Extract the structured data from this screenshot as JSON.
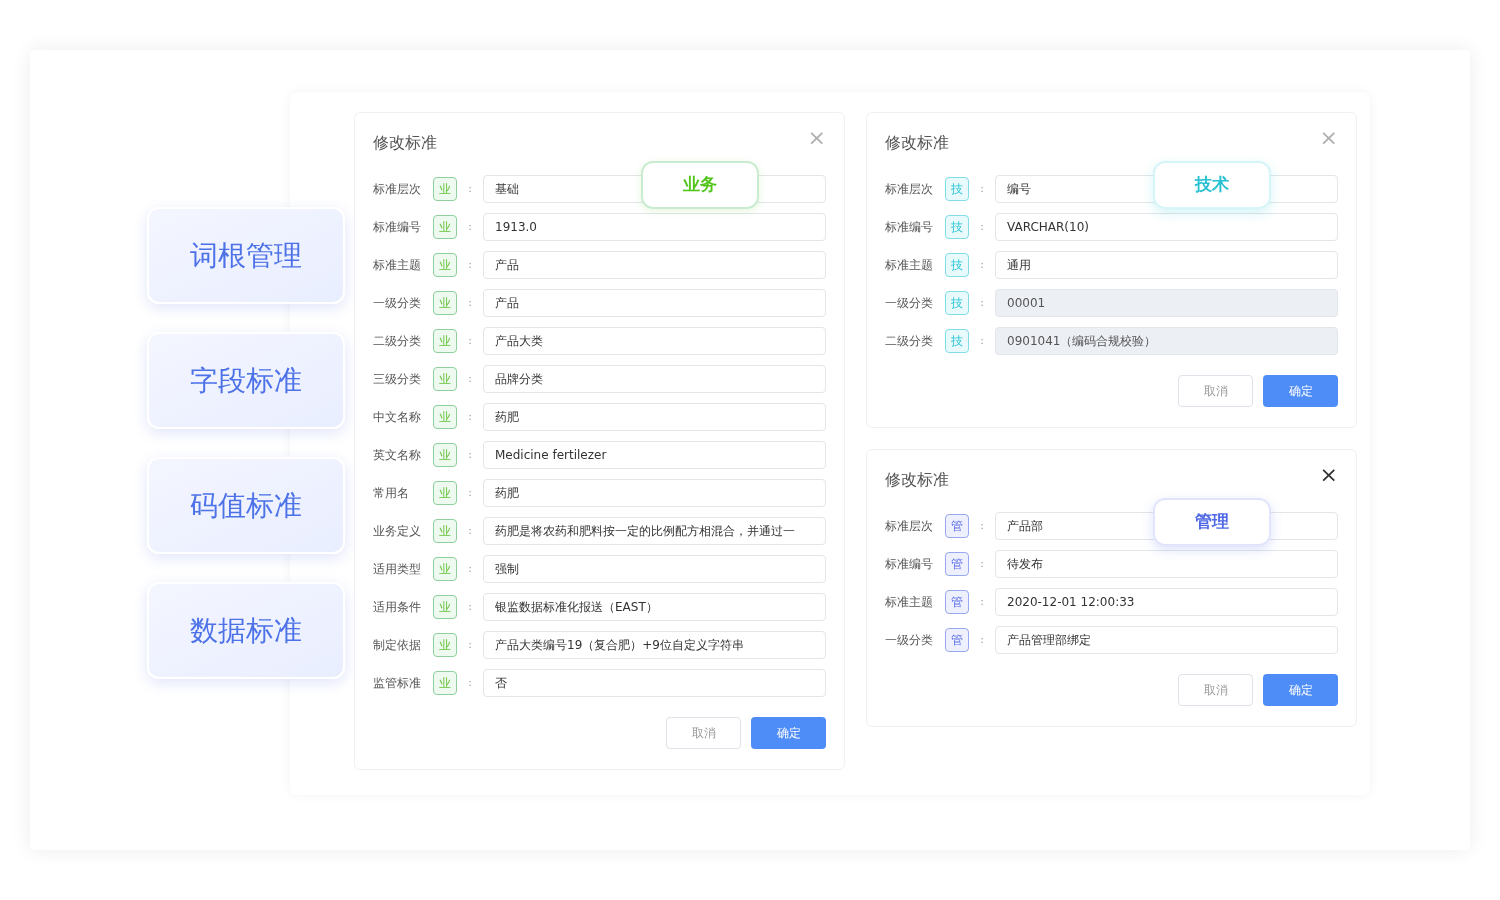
{
  "nav": [
    {
      "label": "词根管理"
    },
    {
      "label": "字段标准"
    },
    {
      "label": "码值标准"
    },
    {
      "label": "数据标准"
    }
  ],
  "dialogs": [
    {
      "title": "修改标准",
      "close": "×",
      "close_active": false,
      "kind": "business",
      "badge": "业务",
      "rows": [
        {
          "label": "标准层次",
          "tag": "业",
          "colon": ":",
          "value": "基础",
          "disabled": false
        },
        {
          "label": "标准编号",
          "tag": "业",
          "colon": ":",
          "value": "1913.0",
          "disabled": false
        },
        {
          "label": "标准主题",
          "tag": "业",
          "colon": ":",
          "value": "产品",
          "disabled": false
        },
        {
          "label": "一级分类",
          "tag": "业",
          "colon": ":",
          "value": "产品",
          "disabled": false
        },
        {
          "label": "二级分类",
          "tag": "业",
          "colon": ":",
          "value": "产品大类",
          "disabled": false
        },
        {
          "label": "三级分类",
          "tag": "业",
          "colon": ":",
          "value": "品牌分类",
          "disabled": false
        },
        {
          "label": "中文名称",
          "tag": "业",
          "colon": ":",
          "value": "药肥",
          "disabled": false
        },
        {
          "label": "英文名称",
          "tag": "业",
          "colon": ":",
          "value": "Medicine fertilezer",
          "disabled": false
        },
        {
          "label": "常用名",
          "tag": "业",
          "colon": ":",
          "value": "药肥",
          "disabled": false
        },
        {
          "label": "业务定义",
          "tag": "业",
          "colon": ":",
          "value": "药肥是将农药和肥料按一定的比例配方相混合，并通过一",
          "disabled": false
        },
        {
          "label": "适用类型",
          "tag": "业",
          "colon": ":",
          "value": "强制",
          "disabled": false
        },
        {
          "label": "适用条件",
          "tag": "业",
          "colon": ":",
          "value": "银监数据标准化报送（EAST）",
          "disabled": false
        },
        {
          "label": "制定依据",
          "tag": "业",
          "colon": ":",
          "value": "产品大类编号19（复合肥）+9位自定义字符串",
          "disabled": false
        },
        {
          "label": "监管标准",
          "tag": "业",
          "colon": ":",
          "value": "否",
          "disabled": false
        }
      ],
      "buttons": {
        "cancel": "取消",
        "confirm": "确定"
      }
    },
    {
      "title": "修改标准",
      "close": "×",
      "close_active": false,
      "kind": "tech",
      "badge": "技术",
      "rows": [
        {
          "label": "标准层次",
          "tag": "技",
          "colon": ":",
          "value": "编号",
          "disabled": false
        },
        {
          "label": "标准编号",
          "tag": "技",
          "colon": ":",
          "value": "VARCHAR(10)",
          "disabled": false
        },
        {
          "label": "标准主题",
          "tag": "技",
          "colon": ":",
          "value": "通用",
          "disabled": false
        },
        {
          "label": "一级分类",
          "tag": "技",
          "colon": ":",
          "value": "00001",
          "disabled": true
        },
        {
          "label": "二级分类",
          "tag": "技",
          "colon": ":",
          "value": "0901041（编码合规校验）",
          "disabled": true
        }
      ],
      "buttons": {
        "cancel": "取消",
        "confirm": "确定"
      }
    },
    {
      "title": "修改标准",
      "close": "×",
      "close_active": true,
      "kind": "manage",
      "badge": "管理",
      "rows": [
        {
          "label": "标准层次",
          "tag": "管",
          "colon": ":",
          "value": "产品部",
          "disabled": false
        },
        {
          "label": "标准编号",
          "tag": "管",
          "colon": ":",
          "value": "待发布",
          "disabled": false
        },
        {
          "label": "标准主题",
          "tag": "管",
          "colon": ":",
          "value": "2020-12-01 12:00:33",
          "disabled": false
        },
        {
          "label": "一级分类",
          "tag": "管",
          "colon": ":",
          "value": "产品管理部绑定",
          "disabled": false
        }
      ],
      "buttons": {
        "cancel": "取消",
        "confirm": "确定"
      }
    }
  ]
}
